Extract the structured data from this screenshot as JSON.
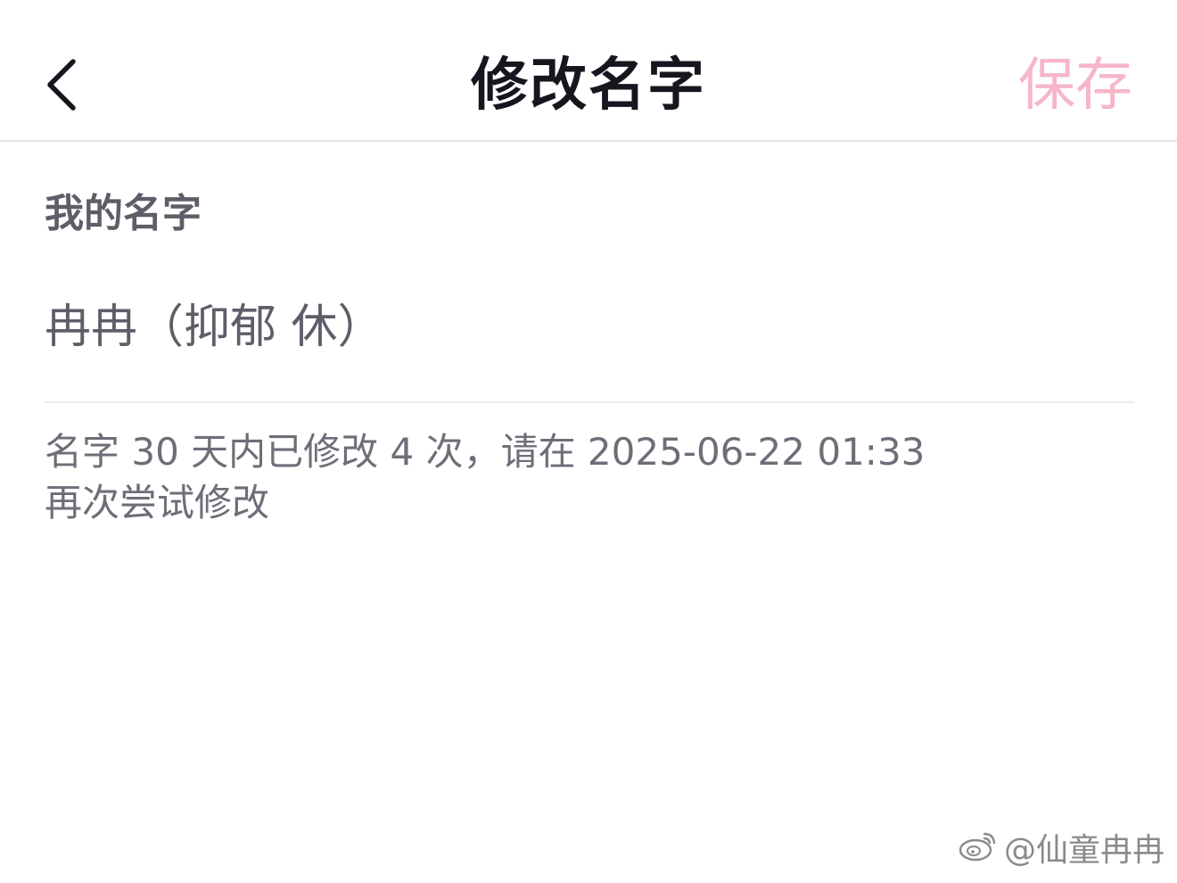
{
  "nav": {
    "title": "修改名字",
    "save_label": "保存"
  },
  "form": {
    "section_label": "我的名字",
    "name_value": "冉冉（抑郁 休）",
    "hint_line1": "名字 30 天内已修改 4 次，请在 2025-06-22 01:33",
    "hint_line2": "再次尝试修改"
  },
  "watermark": {
    "text": "@仙童冉冉"
  },
  "colors": {
    "title": "#16161e",
    "save_disabled": "#f7b6c8",
    "secondary_text": "#5e5e68",
    "divider": "#e2e2e6"
  }
}
